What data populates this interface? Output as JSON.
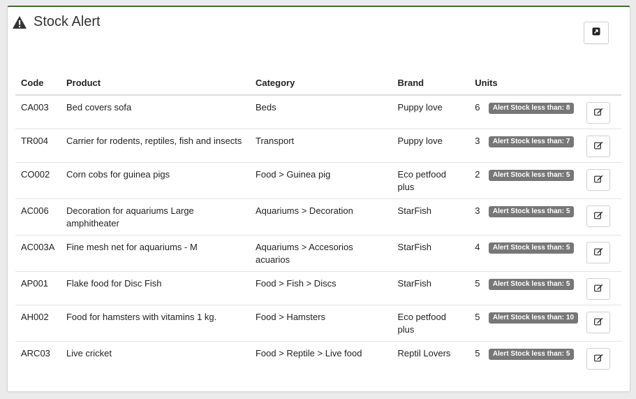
{
  "panel": {
    "title": "Stock Alert",
    "icon": "warning-icon",
    "export_icon": "external-link-icon"
  },
  "table": {
    "headers": {
      "code": "Code",
      "product": "Product",
      "category": "Category",
      "brand": "Brand",
      "units": "Units"
    },
    "rows": [
      {
        "code": "CA003",
        "product": "Bed covers sofa",
        "category": "Beds",
        "brand": "Puppy love",
        "units": "6",
        "alert": "Alert Stock less than: 8"
      },
      {
        "code": "TR004",
        "product": "Carrier for rodents, reptiles, fish and insects",
        "category": "Transport",
        "brand": "Puppy love",
        "units": "3",
        "alert": "Alert Stock less than: 7"
      },
      {
        "code": "CO002",
        "product": "Corn cobs for guinea pigs",
        "category": "Food > Guinea pig",
        "brand": "Eco petfood plus",
        "units": "2",
        "alert": "Alert Stock less than: 5"
      },
      {
        "code": "AC006",
        "product": "Decoration for aquariums Large amphitheater",
        "category": "Aquariums > Decoration",
        "brand": "StarFish",
        "units": "3",
        "alert": "Alert Stock less than: 5"
      },
      {
        "code": "AC003A",
        "product": "Fine mesh net for aquariums - M",
        "category": "Aquariums > Accesorios acuarios",
        "brand": "StarFish",
        "units": "4",
        "alert": "Alert Stock less than: 5"
      },
      {
        "code": "AP001",
        "product": "Flake food for Disc Fish",
        "category": "Food > Fish > Discs",
        "brand": "StarFish",
        "units": "5",
        "alert": "Alert Stock less than: 5"
      },
      {
        "code": "AH002",
        "product": "Food for hamsters with vitamins 1 kg.",
        "category": "Food > Hamsters",
        "brand": "Eco petfood plus",
        "units": "5",
        "alert": "Alert Stock less than: 10"
      },
      {
        "code": "ARC03",
        "product": "Live cricket",
        "category": "Food > Reptile > Live food",
        "brand": "Reptil Lovers",
        "units": "5",
        "alert": "Alert Stock less than: 5"
      }
    ]
  },
  "colors": {
    "panel_accent": "#3e6f28",
    "badge": "#777777"
  }
}
